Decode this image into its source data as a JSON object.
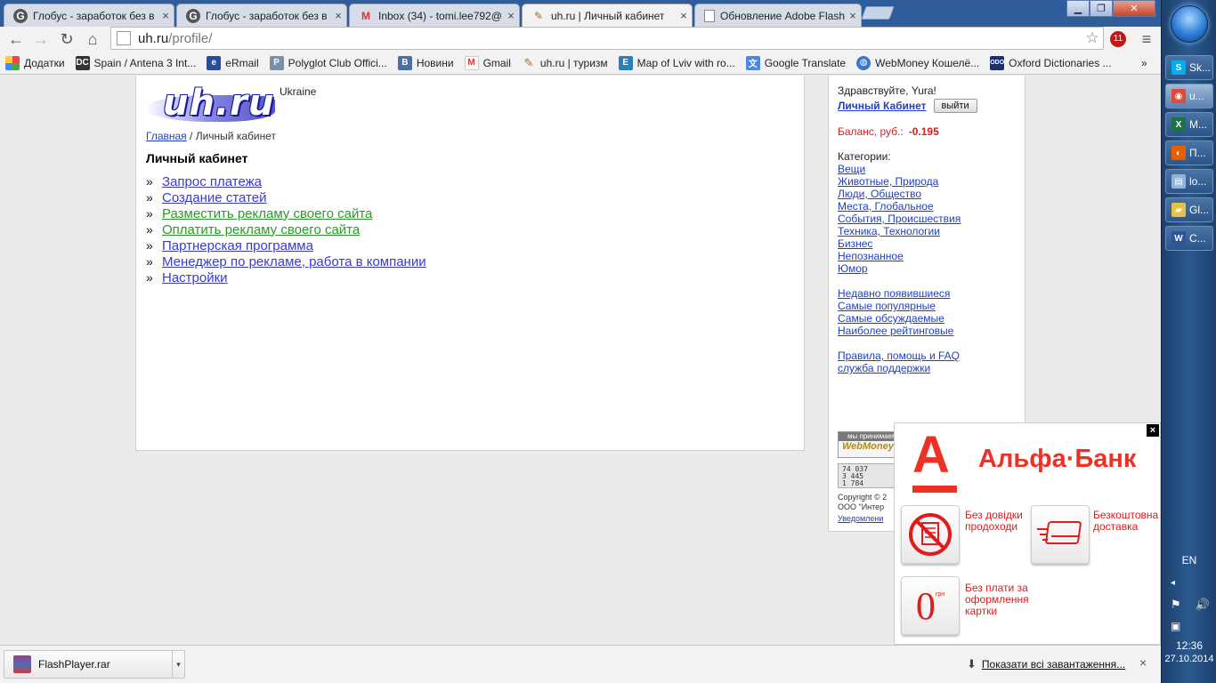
{
  "browser": {
    "tabs": [
      {
        "title": "Глобус - заработок без в",
        "icon": "google-icon"
      },
      {
        "title": "Глобус - заработок без в",
        "icon": "google-icon"
      },
      {
        "title": "Inbox (34) - tomi.lee792@",
        "icon": "gmail-icon"
      },
      {
        "title": "uh.ru | Личный кабинет",
        "icon": "pencil-icon",
        "active": true
      },
      {
        "title": "Обновление Adobe Flash",
        "icon": "page-icon"
      }
    ],
    "url_host": "uh.ru",
    "url_path": "/profile/",
    "bookmarks": [
      {
        "label": "Додатки",
        "icon": "apps-grid-icon"
      },
      {
        "label": "Spain / Antena 3 Int...",
        "icon": "dc-icon"
      },
      {
        "label": "eRmail",
        "icon": "ermail-icon"
      },
      {
        "label": "Polyglot Club Offici...",
        "icon": "polyglot-icon"
      },
      {
        "label": "Новини",
        "icon": "vk-icon"
      },
      {
        "label": "Gmail",
        "icon": "gmail-icon"
      },
      {
        "label": "uh.ru | туризм",
        "icon": "pencil-icon"
      },
      {
        "label": "Map of Lviv with ro...",
        "icon": "e-icon"
      },
      {
        "label": "Google Translate",
        "icon": "translate-icon"
      },
      {
        "label": "WebMoney Кошелё...",
        "icon": "globe-icon"
      },
      {
        "label": "Oxford Dictionaries ...",
        "icon": "odo-icon"
      }
    ],
    "bookmarks_overflow": "»"
  },
  "page": {
    "logo_text": "uh.ru",
    "region": "Ukraine",
    "breadcrumb_home": "Главная",
    "breadcrumb_sep": " / ",
    "breadcrumb_current": "Личный кабинет",
    "title": "Личный кабинет",
    "menu": [
      {
        "label": "Запрос платежа",
        "color": "#3a3ad0"
      },
      {
        "label": "Создание статей",
        "color": "#3a3ad0"
      },
      {
        "label": "Разместить рекламу своего сайта",
        "color": "#2a9a2a"
      },
      {
        "label": "Оплатить рекламу своего сайта",
        "color": "#2a9a2a"
      },
      {
        "label": "Партнерская программа",
        "color": "#3a3ad0"
      },
      {
        "label": "Менеджер по рекламе, работа в компании",
        "color": "#3a3ad0"
      },
      {
        "label": "Настройки",
        "color": "#3a3ad0"
      }
    ],
    "bullet": "»"
  },
  "sidebar": {
    "greeting": "Здравствуйте, Yura!",
    "cabinet_link": "Личный Кабинет",
    "logout_button": "выйти",
    "balance_label": "Баланс, руб.:",
    "balance_value": "-0.195",
    "categories_title": "Категории:",
    "categories": [
      "Вещи",
      "Животные, Природа",
      "Люди, Общество",
      "Места, Глобальное",
      "События, Происшествия",
      "Техника, Технологии",
      "Бизнес",
      "Непознанное",
      "Юмор"
    ],
    "lists": [
      "Недавно появившиеся",
      "Самые популярные",
      "Самые обсуждаемые",
      "Наиболее рейтинговые"
    ],
    "help": [
      "Правила, помощь и FAQ",
      "служба поддержки"
    ],
    "accept_text": "мы принимаем",
    "accept_brand": "WebMoney",
    "counter_lines": [
      "74 037",
      "3 445",
      "1 784"
    ],
    "copyright_line1": "Copyright © 2",
    "copyright_line2": "ООО \"Интер",
    "copyright_link": "Уведомлени"
  },
  "ad": {
    "logo_letter": "А",
    "bank_name": "Альфа·Банк",
    "feature1": "Без довідки продоходи",
    "feature2": "Безкоштовна доставка",
    "feature3": "Без плати за оформлення картки",
    "zero": "0",
    "currency": "грн",
    "close": "×",
    "brand_color": "#ef3124"
  },
  "downloads": {
    "file": "FlashPlayer.rar",
    "show_all": "Показати всі завантаження...",
    "close": "×"
  },
  "taskbar": {
    "items": [
      {
        "label": "Sk...",
        "icon": "skype-icon",
        "color": "#00aff0"
      },
      {
        "label": "u...",
        "icon": "chrome-icon",
        "color": "#dd4b39",
        "active": true
      },
      {
        "label": "M...",
        "icon": "excel-icon",
        "color": "#1e7145"
      },
      {
        "label": "П...",
        "icon": "firefox-icon",
        "color": "#e66000"
      },
      {
        "label": "lo...",
        "icon": "notepad-icon",
        "color": "#8fb6d8"
      },
      {
        "label": "Gl...",
        "icon": "folder-icon",
        "color": "#e8c04a"
      },
      {
        "label": "C...",
        "icon": "word-icon",
        "color": "#2b579a"
      }
    ],
    "language": "EN",
    "time": "12:36",
    "date": "27.10.2014"
  }
}
